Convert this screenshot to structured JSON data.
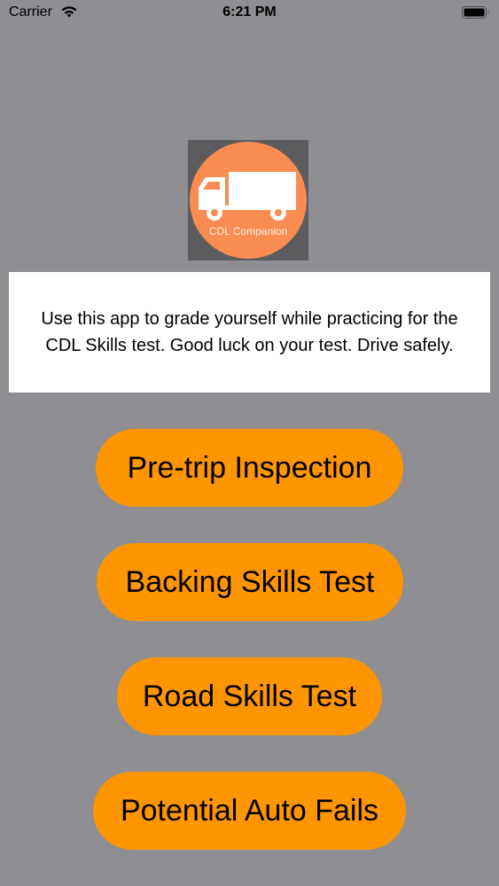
{
  "status_bar": {
    "carrier": "Carrier",
    "time": "6:21 PM",
    "wifi_icon": "wifi-icon",
    "battery_icon": "battery-icon"
  },
  "logo": {
    "icon": "truck-icon",
    "text": "CDL Companion"
  },
  "description": "Use this app to grade yourself while practicing for the CDL Skills test. Good luck on your test. Drive safely.",
  "buttons": {
    "pretrip": "Pre-trip Inspection",
    "backing": "Backing Skills Test",
    "road": "Road Skills Test",
    "autofail": "Potential Auto Fails"
  },
  "colors": {
    "background": "#8e8e93",
    "button": "#ff9500",
    "logo_circle": "#fb8c51",
    "card": "#ffffff"
  }
}
